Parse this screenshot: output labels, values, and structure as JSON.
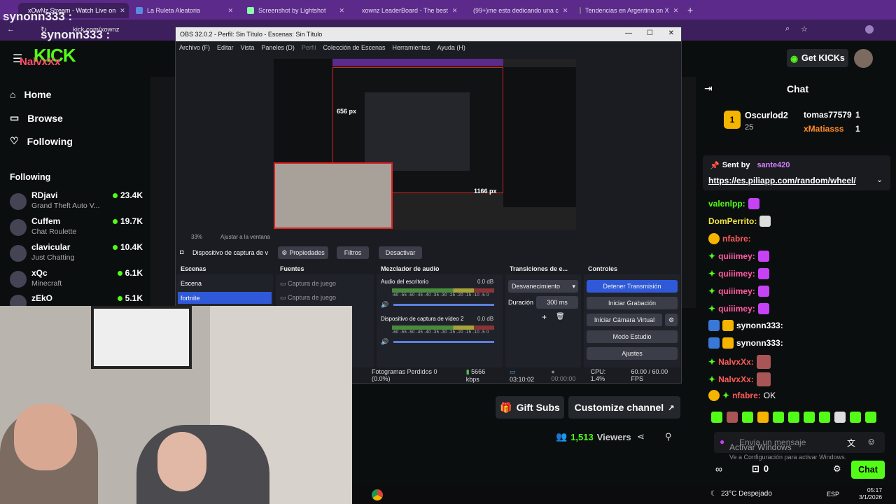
{
  "browser": {
    "tabs": [
      {
        "label": "xOwNz Stream - Watch Live on"
      },
      {
        "label": "La Ruleta Aleatoria"
      },
      {
        "label": "Screenshot by Lightshot"
      },
      {
        "label": "xownz LeaderBoard - The best"
      },
      {
        "label": "(99+)me esta dedicando una c"
      },
      {
        "label": "Tendencias en Argentina on X"
      }
    ],
    "url": "kick.com/xownz"
  },
  "kick": {
    "get_kicks": "Get KICKs",
    "nav": {
      "home": "Home",
      "browse": "Browse",
      "following": "Following"
    },
    "following_title": "Following",
    "following": [
      {
        "name": "RDjavi",
        "category": "Grand Theft Auto V...",
        "viewers": "23.4K"
      },
      {
        "name": "Cuffem",
        "category": "Chat Roulette",
        "viewers": "19.7K"
      },
      {
        "name": "clavicular",
        "category": "Just Chatting",
        "viewers": "10.4K"
      },
      {
        "name": "xQc",
        "category": "Minecraft",
        "viewers": "6.1K"
      },
      {
        "name": "zEkO",
        "category": "",
        "viewers": "5.1K"
      }
    ],
    "gift_subs": "Gift Subs",
    "customize_channel": "Customize channel",
    "viewers_count": "1,513",
    "viewers_label": "Viewers",
    "chat_title": "Chat",
    "leaderboard": {
      "first": "Oscurlod2",
      "first_count": "25",
      "second": "tomas77579",
      "second_count": "1",
      "third": "xMatiasss",
      "third_count": "1"
    },
    "pinned": {
      "sent_by": "Sent by",
      "user": "sante420",
      "link": "https://es.piliapp.com/random/wheel/"
    },
    "messages": [
      {
        "user": "valenlpp:",
        "text": ""
      },
      {
        "user": "DomPerrito:",
        "text": ""
      },
      {
        "user": "nfabre:",
        "text": ""
      },
      {
        "user": "quiiimey:",
        "text": ""
      },
      {
        "user": "quiiimey:",
        "text": ""
      },
      {
        "user": "quiiimey:",
        "text": ""
      },
      {
        "user": "quiiimey:",
        "text": ""
      },
      {
        "user": "synonn333:",
        "text": ""
      },
      {
        "user": "synonn333:",
        "text": ""
      },
      {
        "user": "NalvxXx:",
        "text": ""
      },
      {
        "user": "NalvxXx:",
        "text": ""
      },
      {
        "user": "nfabre:",
        "text": "OK"
      }
    ],
    "send_placeholder": "Envia un mensaje",
    "chat_button": "Chat",
    "kicks_balance": "0",
    "overlay_user": "synonn333 :",
    "overlay_user2": "NalvxXx",
    "overlay_ok": "OK",
    "activate_title": "Activar Windows",
    "activate_sub": "Ve a Configuración para activar Windows."
  },
  "obs": {
    "title": "OBS 32.0.2 - Perfil: Sin Título - Escenas: Sin Título",
    "menu": [
      "Archivo (F)",
      "Editar",
      "Vista",
      "Paneles (D)",
      "Perfil",
      "Colección de Escenas",
      "Herramientas",
      "Ayuda (H)"
    ],
    "zoom": "33%",
    "fit": "Ajustar a la ventana",
    "source_label": "Dispositivo de captura de v",
    "properties": "Propiedades",
    "filters": "Filtros",
    "deactivate": "Desactivar",
    "dim_top": "656 px",
    "dim_bottom": "1166 px",
    "scenes_title": "Escenas",
    "scenes": [
      "Escena",
      "fortnite"
    ],
    "sources_title": "Fuentes",
    "sources": [
      "Captura de juego",
      "Captura de juego"
    ],
    "mixer_title": "Mezclador de audio",
    "mixer": [
      {
        "name": "Audio del escritorio",
        "db": "0.0 dB"
      },
      {
        "name": "Dispositivo de captura de vídeo 2",
        "db": "0.0 dB"
      }
    ],
    "scale_text": "-60 -55 -50 -45 -40 -35 -30 -25 -20 -15 -10 -5 0",
    "transitions_title": "Transiciones de e...",
    "transition": "Desvanecimiento",
    "duration_label": "Duración",
    "duration": "300 ms",
    "controls_title": "Controles",
    "controls": [
      "Detener Transmisión",
      "Iniciar Grabación",
      "Iniciar Cámara Virtual",
      "Modo Estudio",
      "Ajustes"
    ],
    "status": {
      "dropped": "Fotogramas Perdidos 0 (0.0%)",
      "bitrate": "5666 kbps",
      "live_time": "03:10:02",
      "rec_time": "00:00:00",
      "cpu": "CPU: 1.4%",
      "fps": "60.00 / 60.00 FPS"
    }
  },
  "taskbar": {
    "weather": "23°C  Despejado",
    "lang": "ESP",
    "time": "05:17",
    "date": "3/1/2026"
  },
  "colors": {
    "kick_green": "#53fc18",
    "tab_purple": "#5b2a8a",
    "obs_blue": "#2f59d8"
  }
}
